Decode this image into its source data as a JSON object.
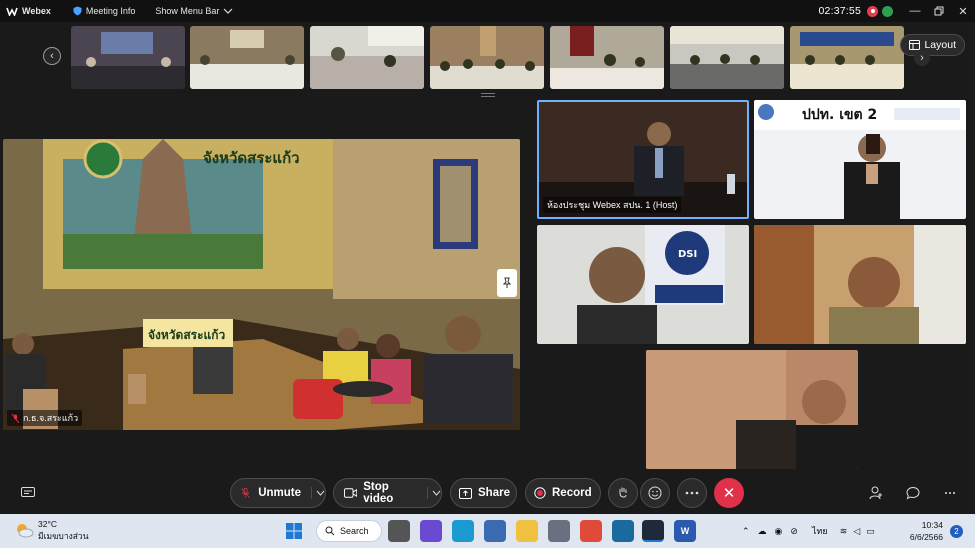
{
  "topbar": {
    "app_name": "Webex",
    "meeting_info": "Meeting Info",
    "show_menu_bar": "Show Menu Bar",
    "timer": "02:37:55",
    "accent": "#e0414f"
  },
  "filmstrip": {
    "layout_label": "Layout",
    "thumbnails": [
      {
        "label": "participant-1"
      },
      {
        "label": "participant-2"
      },
      {
        "label": "participant-3"
      },
      {
        "label": "participant-4"
      },
      {
        "label": "participant-5"
      },
      {
        "label": "participant-6"
      },
      {
        "label": "participant-7"
      }
    ]
  },
  "main_video": {
    "banner_text": "จังหวัดสระแก้ว",
    "table_sign": "จังหวัดสระแก้ว",
    "name": "ก.ธ.จ.สระแก้ว"
  },
  "tiles": {
    "host_name": "ห้องประชุม Webex สปน. 1 (Host)",
    "pacc_banner": "ปปท. เขต 2",
    "dsi_label": "DSI"
  },
  "controls": {
    "unmute": "Unmute",
    "stop_video": "Stop video",
    "share": "Share",
    "record": "Record",
    "leave_color": "#e0304a"
  },
  "taskbar": {
    "temperature": "32°C",
    "weather_desc": "มีเมฆบางส่วน",
    "search": "Search",
    "language": "ไทย",
    "time": "10:34",
    "date": "6/6/2566",
    "notifications": "2"
  }
}
